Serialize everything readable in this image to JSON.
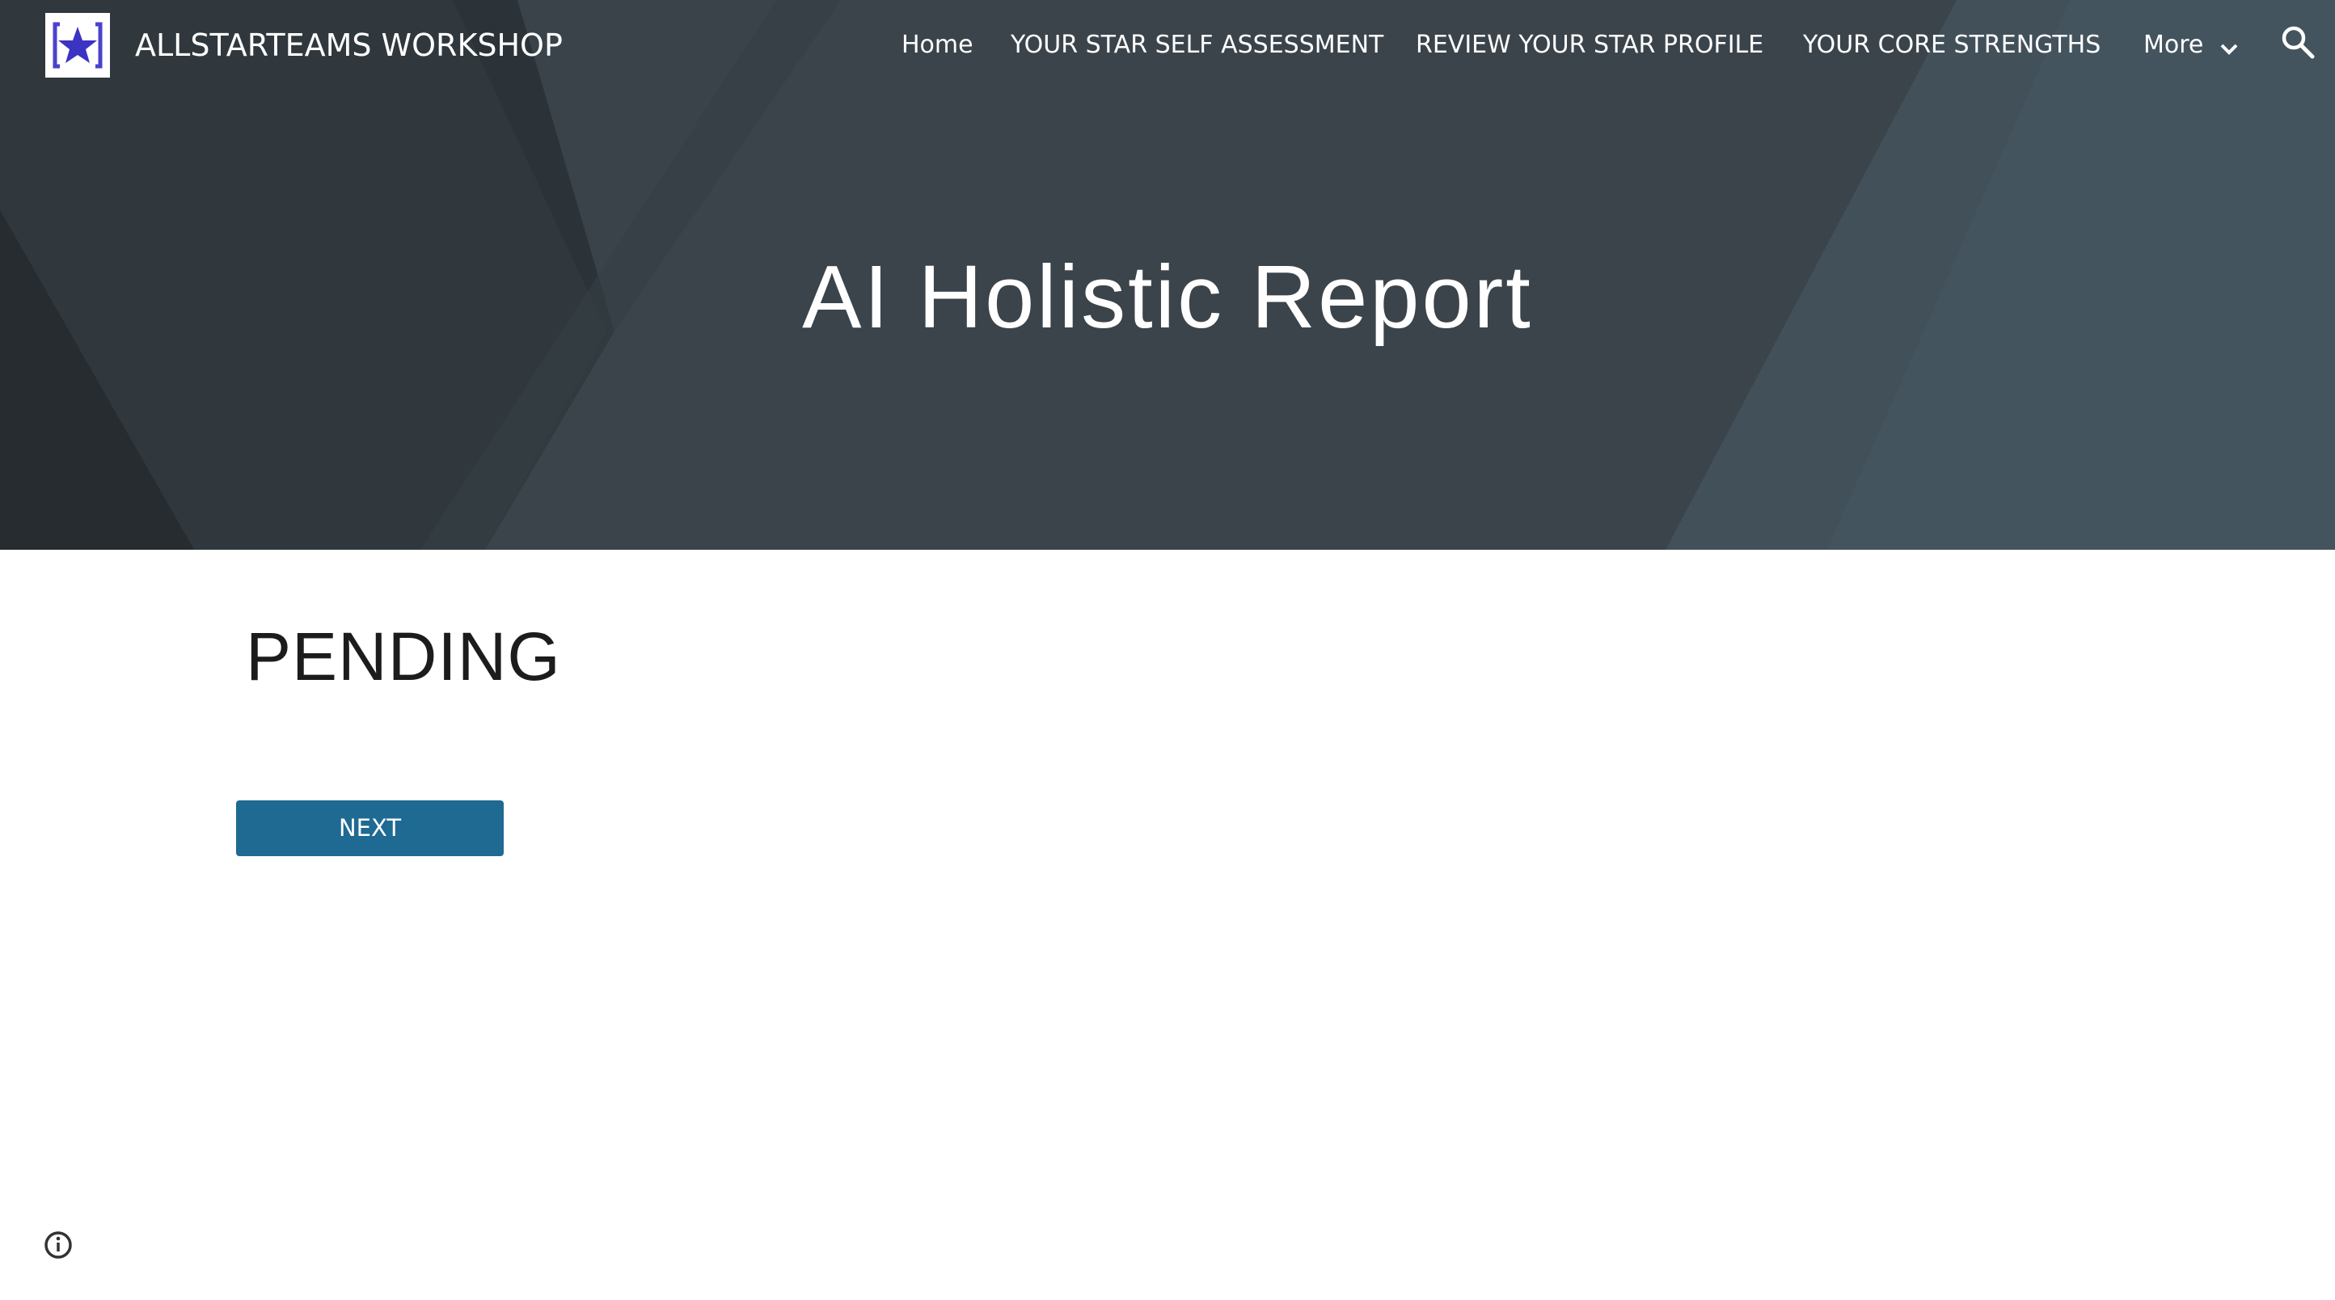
{
  "site": {
    "title": "ALLSTARTEAMS WORKSHOP",
    "logo_icon": "star-logo-icon"
  },
  "nav": {
    "items": [
      {
        "label": "Home"
      },
      {
        "label": "YOUR STAR SELF ASSESSMENT"
      },
      {
        "label": "REVIEW YOUR STAR PROFILE"
      },
      {
        "label": "YOUR CORE STRENGTHS"
      },
      {
        "label": "More"
      }
    ],
    "more_icon": "chevron-down-icon",
    "search_icon": "search-icon"
  },
  "hero": {
    "title": "AI Holistic Report"
  },
  "main": {
    "status": "PENDING",
    "next_label": "NEXT"
  },
  "footer": {
    "info_icon": "info-icon"
  },
  "colors": {
    "hero_bg": "#343d44",
    "button": "#1e6a92",
    "logo_star": "#3b33c2",
    "logo_frame": "#4a42cc"
  }
}
